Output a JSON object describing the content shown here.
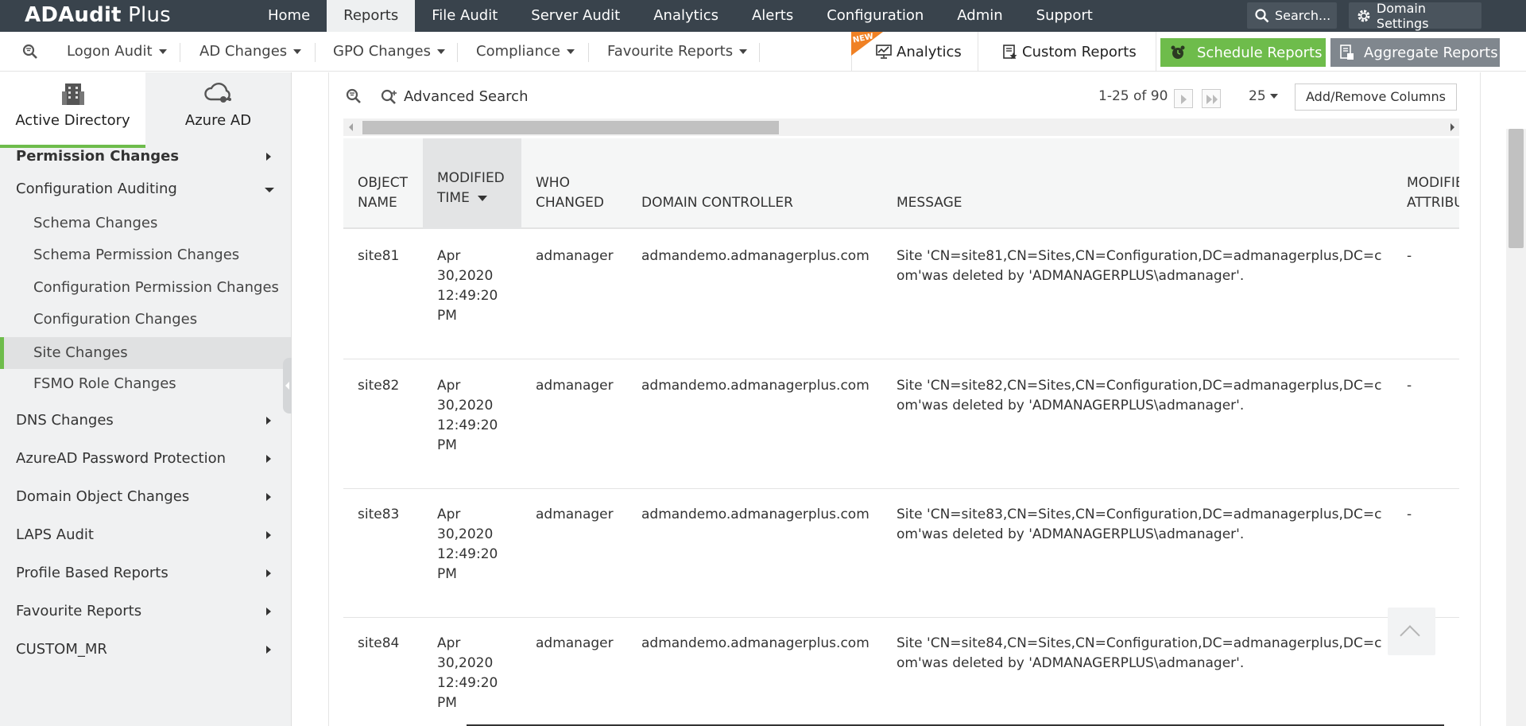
{
  "app": {
    "name_bold": "ADAudit",
    "name_light": " Plus"
  },
  "topnav": [
    {
      "label": "Home"
    },
    {
      "label": "Reports"
    },
    {
      "label": "File Audit"
    },
    {
      "label": "Server Audit"
    },
    {
      "label": "Analytics"
    },
    {
      "label": "Alerts"
    },
    {
      "label": "Configuration"
    },
    {
      "label": "Admin"
    },
    {
      "label": "Support"
    }
  ],
  "header": {
    "search_label": "Search...",
    "domain_settings_label": "Domain Settings"
  },
  "subnav": {
    "menus": [
      {
        "label": "Logon Audit"
      },
      {
        "label": "AD Changes"
      },
      {
        "label": "GPO Changes"
      },
      {
        "label": "Compliance"
      },
      {
        "label": "Favourite Reports"
      }
    ],
    "new_badge": "NEW",
    "analytics_label": "Analytics",
    "custom_reports_label": "Custom Reports",
    "schedule_reports_label": "Schedule Reports",
    "aggregate_reports_label": "Aggregate Reports"
  },
  "sidebar": {
    "tabs": [
      {
        "label": "Active Directory"
      },
      {
        "label": "Azure AD"
      }
    ],
    "items": [
      {
        "label": "Permission Changes"
      },
      {
        "label": "Configuration Auditing"
      },
      {
        "label": "Schema Changes"
      },
      {
        "label": "Schema Permission Changes"
      },
      {
        "label": "Configuration Permission Changes"
      },
      {
        "label": "Configuration Changes"
      },
      {
        "label": "Site Changes"
      },
      {
        "label": "FSMO Role Changes"
      },
      {
        "label": "DNS Changes"
      },
      {
        "label": "AzureAD Password Protection"
      },
      {
        "label": "Domain Object Changes"
      },
      {
        "label": "LAPS Audit"
      },
      {
        "label": "Profile Based Reports"
      },
      {
        "label": "Favourite Reports"
      },
      {
        "label": "CUSTOM_MR"
      }
    ]
  },
  "report": {
    "advanced_search_label": "Advanced Search",
    "pager_text": "1-25 of 90",
    "page_size": "25",
    "add_remove_columns_label": "Add/Remove Columns",
    "columns": {
      "object_name": "OBJECT NAME",
      "modified_time": "MODIFIED TIME",
      "who_changed": "WHO CHANGED",
      "domain_controller": "DOMAIN CONTROLLER",
      "message": "MESSAGE",
      "modified_attributes": "MODIFIED ATTRIBUTES"
    },
    "rows": [
      {
        "object_name": "site81",
        "modified_time": "Apr 30,2020 12:49:20 PM",
        "who_changed": "admanager",
        "domain_controller": "admandemo.admanagerplus.com",
        "message": "Site 'CN=site81,CN=Sites,CN=Configuration,DC=admanagerplus,DC=com'was deleted by 'ADMANAGERPLUS\\admanager'.",
        "modified_attributes": "-"
      },
      {
        "object_name": "site82",
        "modified_time": "Apr 30,2020 12:49:20 PM",
        "who_changed": "admanager",
        "domain_controller": "admandemo.admanagerplus.com",
        "message": "Site 'CN=site82,CN=Sites,CN=Configuration,DC=admanagerplus,DC=com'was deleted by 'ADMANAGERPLUS\\admanager'.",
        "modified_attributes": "-"
      },
      {
        "object_name": "site83",
        "modified_time": "Apr 30,2020 12:49:20 PM",
        "who_changed": "admanager",
        "domain_controller": "admandemo.admanagerplus.com",
        "message": "Site 'CN=site83,CN=Sites,CN=Configuration,DC=admanagerplus,DC=com'was deleted by 'ADMANAGERPLUS\\admanager'.",
        "modified_attributes": "-"
      },
      {
        "object_name": "site84",
        "modified_time": "Apr 30,2020 12:49:20 PM",
        "who_changed": "admanager",
        "domain_controller": "admandemo.admanagerplus.com",
        "message": "Site 'CN=site84,CN=Sites,CN=Configuration,DC=admanagerplus,DC=com'was deleted by 'ADMANAGERPLUS\\admanager'.",
        "modified_attributes": "-"
      }
    ]
  },
  "colors": {
    "topbar": "#39434c",
    "accent_green": "#6ebc4b",
    "aggregate_gray": "#80878e",
    "new_orange": "#f08124"
  },
  "icons": [
    "search-icon",
    "gear-icon",
    "filter-search-icon",
    "analytics-icon",
    "custom-reports-icon",
    "alarm-clock-icon",
    "aggregate-reports-icon",
    "building-icon",
    "cloud-icon",
    "back-to-top-icon"
  ]
}
